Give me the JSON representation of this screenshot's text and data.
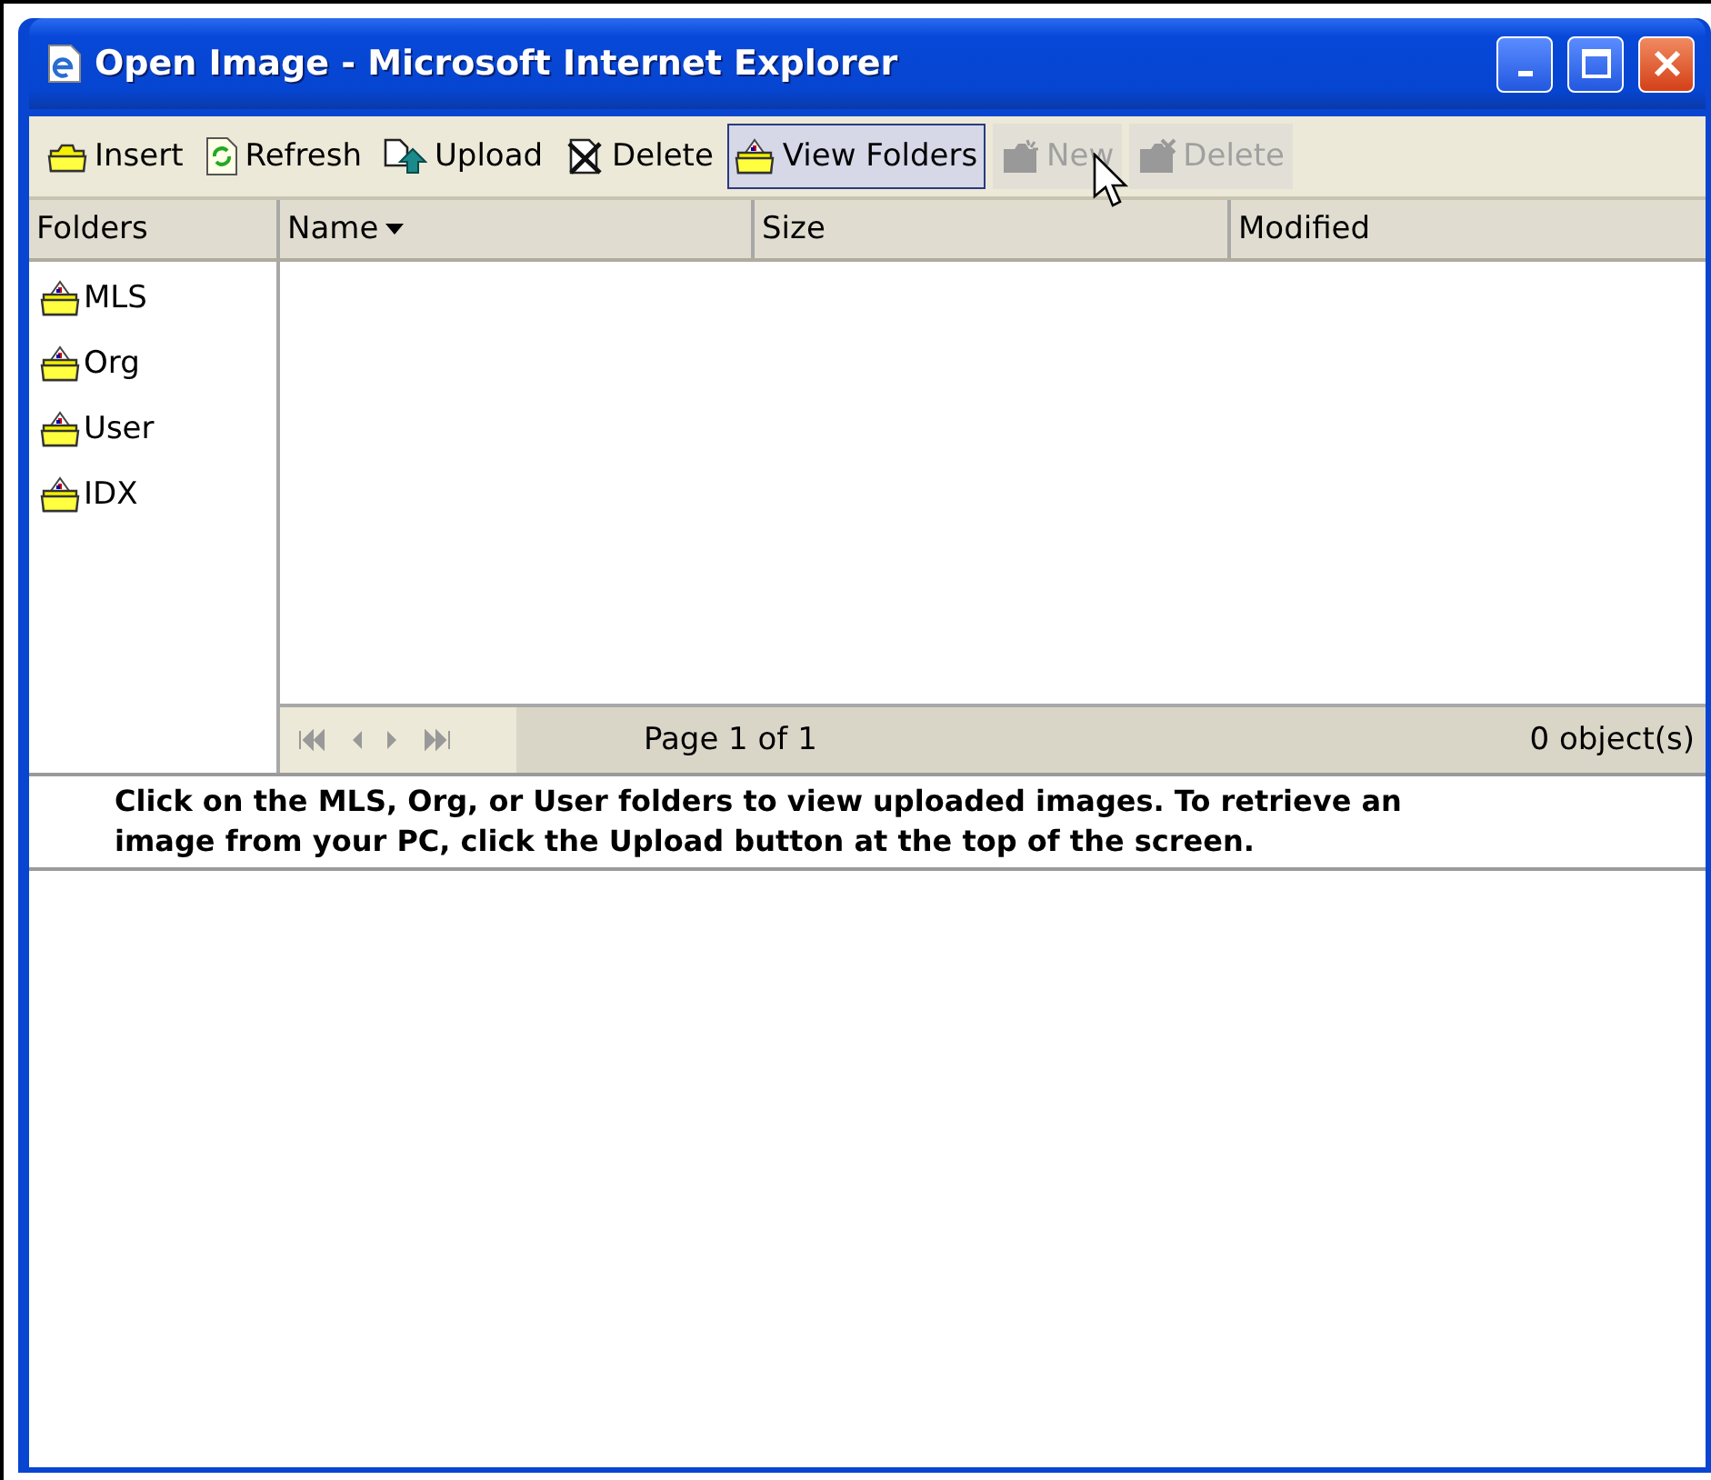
{
  "window": {
    "title": "Open Image - Microsoft Internet Explorer"
  },
  "toolbar": [
    {
      "label": "Insert",
      "kind": "insert",
      "disabled": false,
      "selected": false
    },
    {
      "label": "Refresh",
      "kind": "refresh",
      "disabled": false,
      "selected": false
    },
    {
      "label": "Upload",
      "kind": "upload",
      "disabled": false,
      "selected": false
    },
    {
      "label": "Delete",
      "kind": "delete",
      "disabled": false,
      "selected": false
    },
    {
      "label": "View Folders",
      "kind": "folders",
      "disabled": false,
      "selected": true
    },
    {
      "label": "New",
      "kind": "new",
      "disabled": true,
      "selected": false
    },
    {
      "label": "Delete",
      "kind": "remove",
      "disabled": true,
      "selected": false
    }
  ],
  "columns": [
    {
      "label": "Folders",
      "sorted": false
    },
    {
      "label": "Name",
      "sorted": true
    },
    {
      "label": "Size",
      "sorted": false
    },
    {
      "label": "Modified",
      "sorted": false
    }
  ],
  "folders": [
    {
      "label": "MLS"
    },
    {
      "label": "Org"
    },
    {
      "label": "User"
    },
    {
      "label": "IDX"
    }
  ],
  "pager": {
    "page": "Page 1 of 1",
    "count": "0 object(s)"
  },
  "message": "Click on the MLS, Org, or User folders to view uploaded images. To retrieve an image from your PC, click the Upload button at the top of the screen."
}
